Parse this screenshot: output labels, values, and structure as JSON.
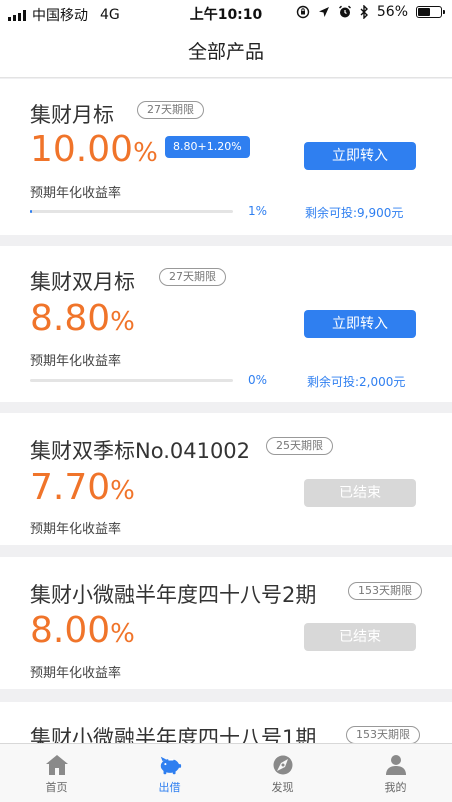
{
  "status_bar": {
    "carrier": "中国移动",
    "network": "4G",
    "time": "上午10:10",
    "battery": "56%",
    "battery_level": 0.56
  },
  "nav": {
    "title": "全部产品"
  },
  "products": [
    {
      "name": "集财月标",
      "term": "27天期限",
      "rate": "10.00",
      "rate_unit": "%",
      "bonus": "8.80+1.20%",
      "rate_label": "预期年化收益率",
      "button": "立即转入",
      "progress": 0.01,
      "progress_text": "1%",
      "remaining": "剩余可投:9,900元"
    },
    {
      "name": "集财双月标",
      "term": "27天期限",
      "rate": "8.80",
      "rate_unit": "%",
      "rate_label": "预期年化收益率",
      "button": "立即转入",
      "progress": 0,
      "progress_text": "0%",
      "remaining": "剩余可投:2,000元"
    },
    {
      "name": "集财双季标No.041002",
      "term": "25天期限",
      "rate": "7.70",
      "rate_unit": "%",
      "rate_label": "预期年化收益率",
      "button": "已结束"
    },
    {
      "name": "集财小微融半年度四十八号2期",
      "term": "153天期限",
      "rate": "8.00",
      "rate_unit": "%",
      "rate_label": "预期年化收益率",
      "button": "已结束"
    },
    {
      "name": "集财小微融半年度四十八号1期",
      "term": "153天期限"
    }
  ],
  "tabs": [
    {
      "label": "首页",
      "icon": "home-icon"
    },
    {
      "label": "出借",
      "icon": "piggy-bank-icon",
      "active": true
    },
    {
      "label": "发现",
      "icon": "compass-icon"
    },
    {
      "label": "我的",
      "icon": "user-icon"
    }
  ],
  "colors": {
    "accent": "#2f7ff0",
    "rate": "#f0742a",
    "ended": "#d8d8d8"
  }
}
